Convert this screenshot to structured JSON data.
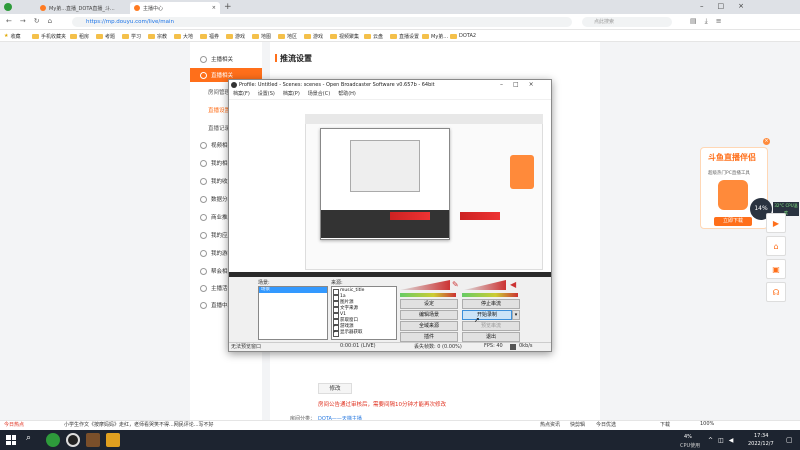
{
  "browser": {
    "tabs": [
      {
        "title": "My弟...直播_DOTA直播_斗..."
      },
      {
        "title": "My弟...直播_DOTA直播_斗鱼..."
      },
      {
        "title": "主播中心"
      }
    ],
    "url": "https://mp.douyu.com/live/main",
    "search_placeholder": "点此搜索",
    "bookmarks": [
      "收藏",
      "手机收藏夹",
      "租房",
      "考题",
      "学习",
      "宗教",
      "大地",
      "福券",
      "游戏",
      "地图",
      "地区",
      "游戏",
      "视频聚集",
      "云盘",
      "直播设置",
      "My弟...",
      "DOTA2"
    ]
  },
  "sidebar": {
    "items": [
      {
        "label": "主播相关"
      },
      {
        "label": "直播相关"
      },
      {
        "label": "视频相关"
      },
      {
        "label": "我的相关"
      },
      {
        "label": "我的收益"
      },
      {
        "label": "数据分析"
      },
      {
        "label": "商业推广"
      },
      {
        "label": "我的应用"
      },
      {
        "label": "我的游戏"
      },
      {
        "label": "帮会相关"
      },
      {
        "label": "主播活动"
      },
      {
        "label": "直播中心"
      }
    ],
    "subitems": [
      {
        "label": "房间管理"
      },
      {
        "label": "直播设置"
      },
      {
        "label": "直播记录"
      }
    ]
  },
  "content": {
    "section_title": "推流设置",
    "modify_button": "修改",
    "notice": "房间公告通过审核后，需要间隔10分钟才能再次修改",
    "footer_label": "房间分类：",
    "footer_link": "DOTA——天梯主播"
  },
  "obs": {
    "title": "Profile: Untitled - Scenes: scenes - Open Broadcaster Software v0.657b - 64bit",
    "menu": [
      "档案(F)",
      "设置(S)",
      "档案(P)",
      "场景合(C)",
      "帮助(H)"
    ],
    "scenes_label": "场景:",
    "scenes": [
      "场景"
    ],
    "sources_label": "来源:",
    "sources": [
      {
        "name": "music_title",
        "checked": false
      },
      {
        "name": "1a",
        "checked": false
      },
      {
        "name": "图片源",
        "checked": false
      },
      {
        "name": "文字来源",
        "checked": false
      },
      {
        "name": "V1",
        "checked": false
      },
      {
        "name": "获取窗口",
        "checked": false
      },
      {
        "name": "游戏源",
        "checked": true
      },
      {
        "name": "显示器获取",
        "checked": true
      }
    ],
    "buttons": {
      "settings": "设定",
      "stop_stream": "停止串流",
      "edit_scene": "编辑场景",
      "start_record": "开始录制",
      "global_sources": "全域来源",
      "preview": "预览串流",
      "plugins": "插件",
      "exit": "退出"
    },
    "status": {
      "left": "无法预览窗口",
      "time": "0:00:01 (LIVE)",
      "dropped": "丢失帧数: 0 (0.00%)",
      "fps": "FPS: 40",
      "bitrate": "0kb/s"
    }
  },
  "promo": {
    "title": "斗鱼直播伴侣",
    "subtitle": "超级热门PC直播工具",
    "button": "立即下载",
    "speed": "14%",
    "cpu": "32°C CPU温度"
  },
  "statusbar": {
    "left": "今日热点",
    "news": "小学生作文《按摩妈妈》走红，老师看哭笑不得...网民评论...写不好",
    "right": [
      "热点资讯",
      "快剪辑",
      "今日优选",
      "下载",
      "100%"
    ]
  },
  "taskbar": {
    "cpu": "4%",
    "cpu_label": "CPU使用",
    "time": "17:34",
    "date": "2022/12/7"
  },
  "colors": {
    "accent": "#ff6f1a",
    "taskbar": "#1d2430"
  }
}
